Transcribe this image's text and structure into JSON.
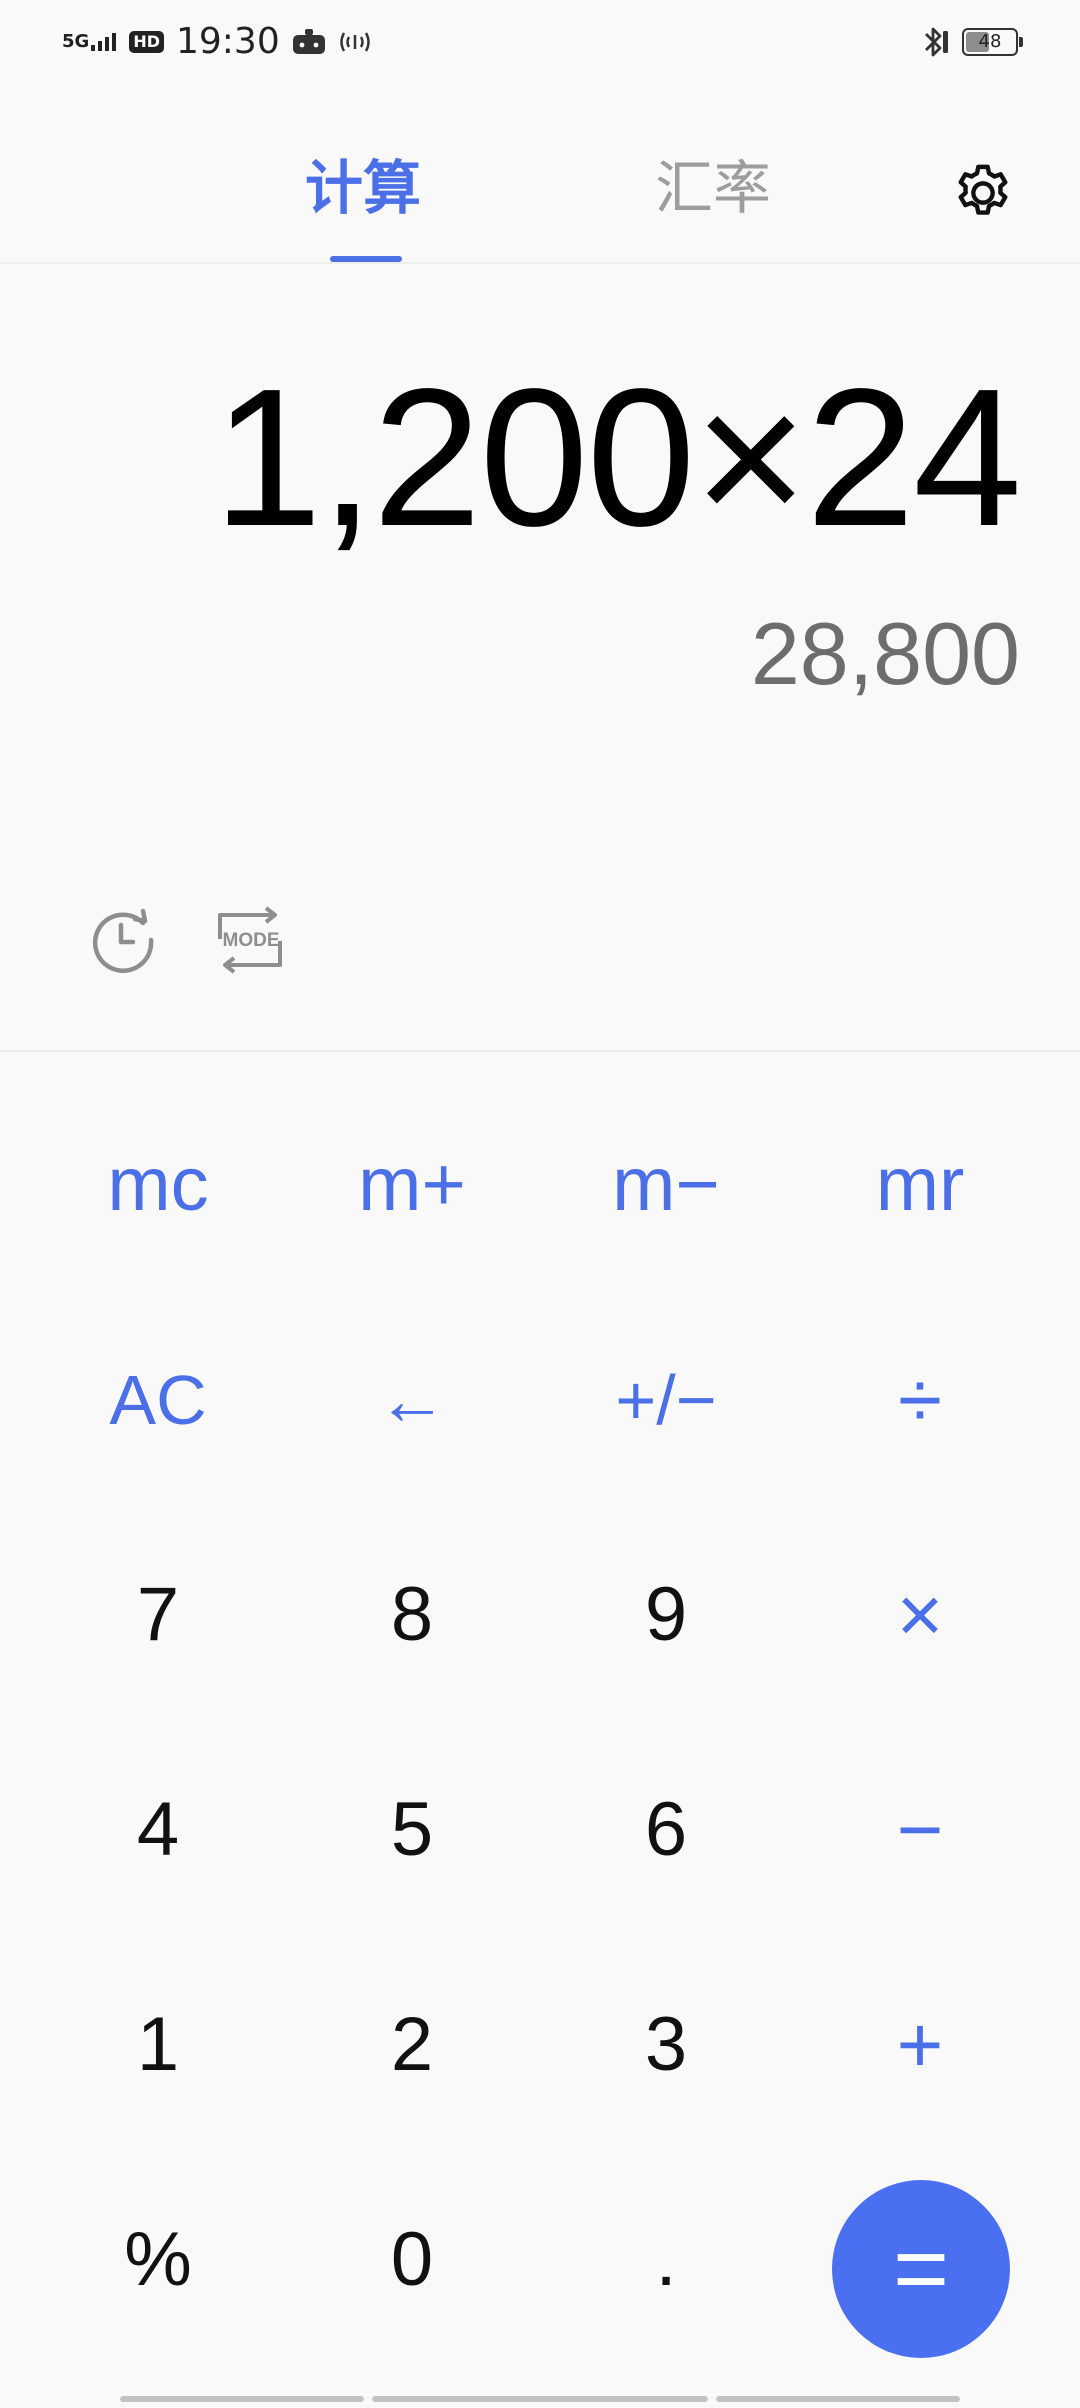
{
  "status_bar": {
    "network": "5G",
    "hd_badge": "HD",
    "time": "19:30",
    "battery_level": "48",
    "battery_fraction": 0.48
  },
  "tabs": [
    {
      "label": "计算",
      "active": true
    },
    {
      "label": "汇率",
      "active": false
    }
  ],
  "display": {
    "expression": "1,200×24",
    "result": "28,800"
  },
  "tools": {
    "history_icon": "history-clock-icon",
    "mode_icon": "mode-switch-icon",
    "mode_text": "MODE"
  },
  "keys": {
    "row1": [
      "mc",
      "m+",
      "m−",
      "mr"
    ],
    "row2": [
      "AC",
      "←",
      "+/−",
      "÷"
    ],
    "row3": [
      "7",
      "8",
      "9",
      "×"
    ],
    "row4": [
      "4",
      "5",
      "6",
      "−"
    ],
    "row5": [
      "1",
      "2",
      "3",
      "+"
    ],
    "row6": [
      "%",
      "0",
      ".",
      "="
    ]
  },
  "colors": {
    "accent": "#4a6fe6",
    "equals_bg": "#4a6ff0",
    "text_primary": "#111111",
    "text_secondary": "#6d6d6d",
    "tab_inactive": "#9d9d9d",
    "background": "#f9f9f9"
  }
}
